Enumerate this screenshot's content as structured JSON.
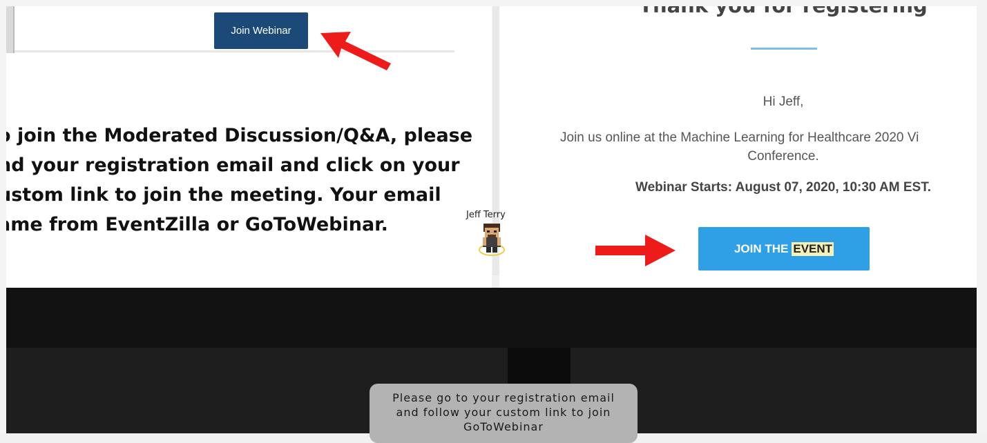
{
  "slide": {
    "join_webinar_label": "Join Webinar",
    "instructions": [
      "o join the Moderated Discussion/Q&A, please",
      "nd your registration email and click on your",
      "ustom link to join the meeting. Your email",
      "ame from EventZilla or GoToWebinar."
    ]
  },
  "email": {
    "title": "Thank you for registering",
    "greeting": "Hi Jeff,",
    "invite_line1": "Join us online at the Machine Learning for Healthcare 2020 Vi",
    "invite_line2": "Conference.",
    "starts": "Webinar Starts: August 07, 2020, 10:30 AM EST.",
    "join_button_part1": "JOIN THE",
    "join_button_part2": "EVENT"
  },
  "avatar": {
    "name": "Jeff Terry"
  },
  "toast": {
    "lines": [
      "Please go to your registration email",
      "and follow your custom link to join",
      "GoToWebinar"
    ]
  },
  "colors": {
    "join_webinar_bg": "#1b4a78",
    "join_event_bg": "#2f9fe6",
    "arrow_red": "#ee1b1b",
    "highlight": "#f6f1b8"
  }
}
